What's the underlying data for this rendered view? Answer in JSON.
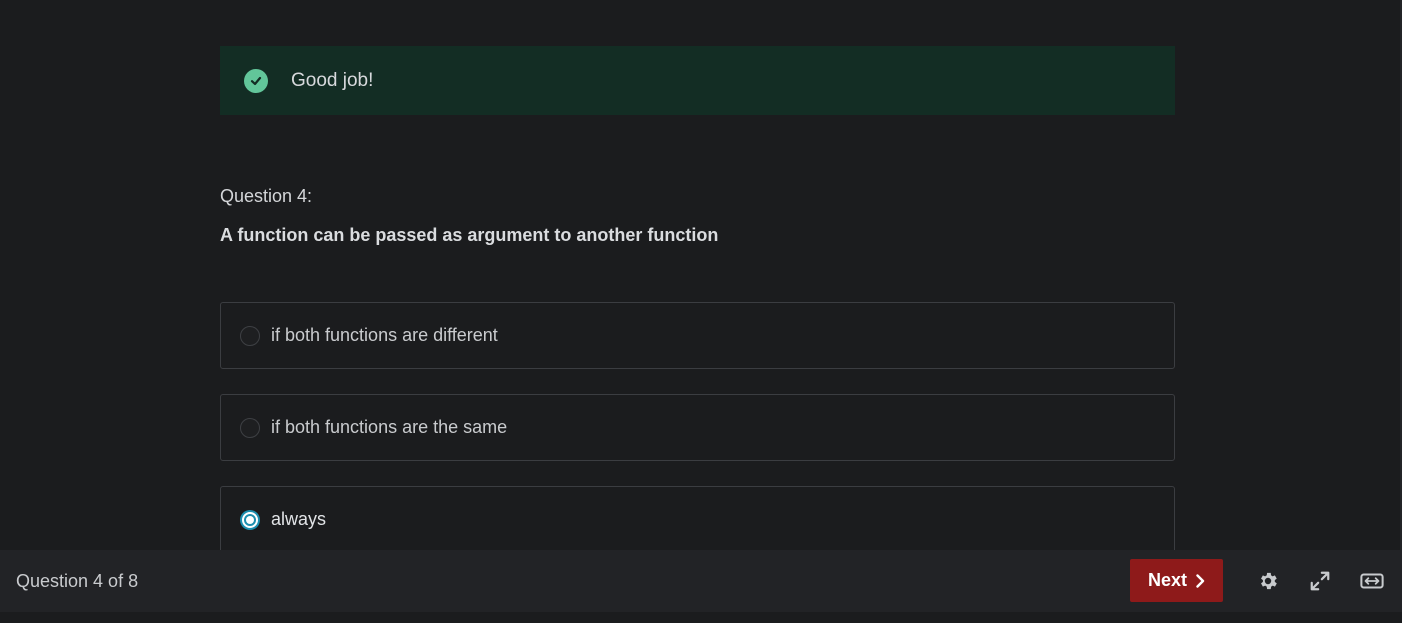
{
  "feedback": {
    "message": "Good job!",
    "icon": "check-circle-icon",
    "color": "#62c69a"
  },
  "question": {
    "label": "Question 4:",
    "text": "A function can be passed as argument to another function"
  },
  "options": [
    {
      "label": "if both functions are different",
      "selected": false
    },
    {
      "label": "if both functions are the same",
      "selected": false
    },
    {
      "label": "always",
      "selected": true
    }
  ],
  "footer": {
    "progress": "Question 4 of 8",
    "next_label": "Next",
    "next_color": "#8e1a1a",
    "icons": [
      "gear-icon",
      "fullscreen-icon",
      "resize-width-icon"
    ]
  }
}
